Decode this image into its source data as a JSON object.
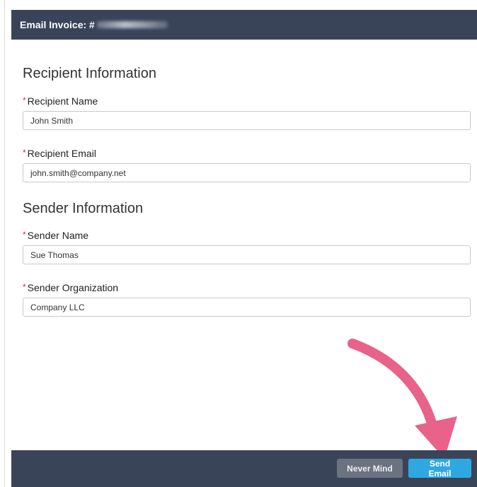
{
  "header": {
    "title": "Email Invoice: #"
  },
  "recipient": {
    "heading": "Recipient Information",
    "name_label": "Recipient Name",
    "name_value": "John Smith",
    "email_label": "Recipient Email",
    "email_value": "john.smith@company.net"
  },
  "sender": {
    "heading": "Sender Information",
    "name_label": "Sender Name",
    "name_value": "Sue Thomas",
    "org_label": "Sender Organization",
    "org_value": "Company LLC"
  },
  "required_marker": "*",
  "footer": {
    "never_mind_label": "Never Mind",
    "send_email_label": "Send Email"
  },
  "colors": {
    "header_bg": "#3a4459",
    "primary": "#2fa7e0",
    "secondary": "#6b7280",
    "required": "#e0233a",
    "arrow": "#e8628a"
  },
  "icons": {
    "annotation": "curved-arrow-icon"
  }
}
